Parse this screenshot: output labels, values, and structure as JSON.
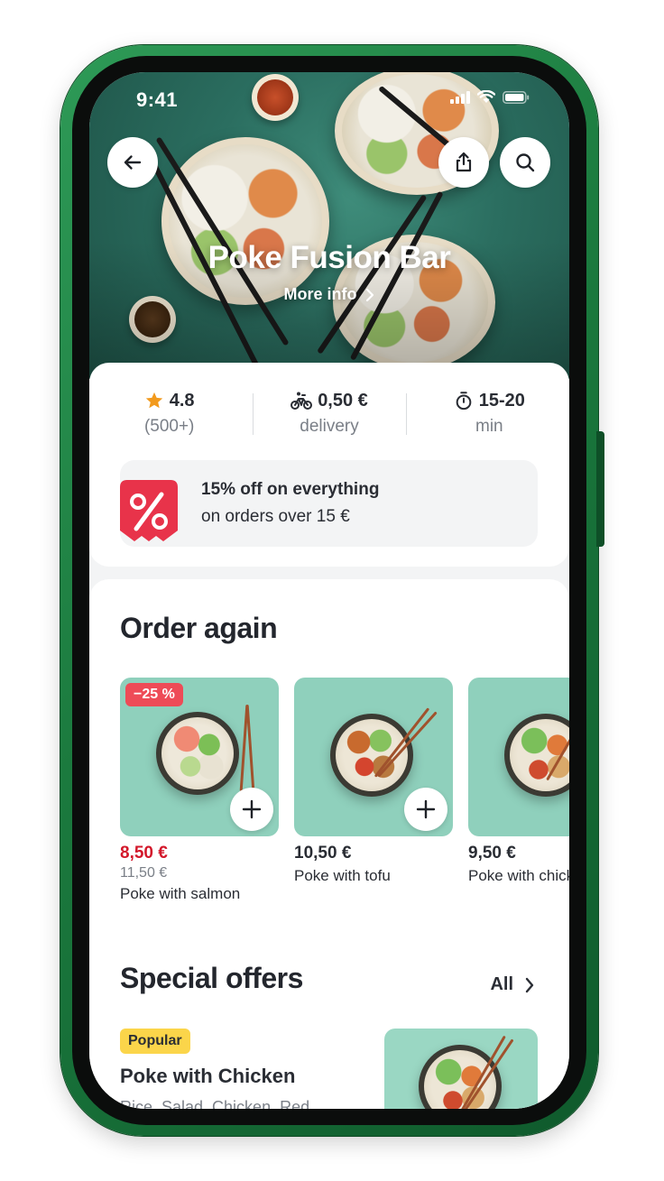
{
  "status_bar": {
    "time": "9:41"
  },
  "header": {
    "restaurant_name": "Poke Fusion Bar",
    "more_info_label": "More info"
  },
  "stats": {
    "rating": "4.8",
    "rating_count": "(500+)",
    "delivery_fee": "0,50 €",
    "delivery_label": "delivery",
    "time_range": "15-20",
    "time_unit": "min"
  },
  "promo": {
    "title": "15% off on everything",
    "subtitle": "on orders over 15 €"
  },
  "order_again": {
    "title": "Order again",
    "items": [
      {
        "discount": "−25 %",
        "price": "8,50 €",
        "old_price": "11,50 €",
        "name": "Poke with salmon"
      },
      {
        "price": "10,50 €",
        "name": "Poke with tofu"
      },
      {
        "price": "9,50 €",
        "name": "Poke with chicken"
      }
    ]
  },
  "special_offers": {
    "title": "Special offers",
    "all_label": "All",
    "featured": {
      "badge": "Popular",
      "name": "Poke with Chicken",
      "description": "Rice, Salad, Chicken, Red..."
    }
  },
  "colors": {
    "frame": "#1b7a3e",
    "sale_price": "#d3182b",
    "discount_tag": "#ee4b57",
    "popular_badge": "#fbd54a",
    "star": "#f29a1d",
    "promo_badge": "#e8334a"
  },
  "icons": {
    "back": "arrow-left-icon",
    "share": "share-icon",
    "search": "search-icon",
    "rating": "star-icon",
    "delivery": "bike-icon",
    "time": "timer-icon",
    "promo": "percent-badge-icon",
    "add": "plus-icon",
    "chevron": "chevron-right-icon"
  }
}
